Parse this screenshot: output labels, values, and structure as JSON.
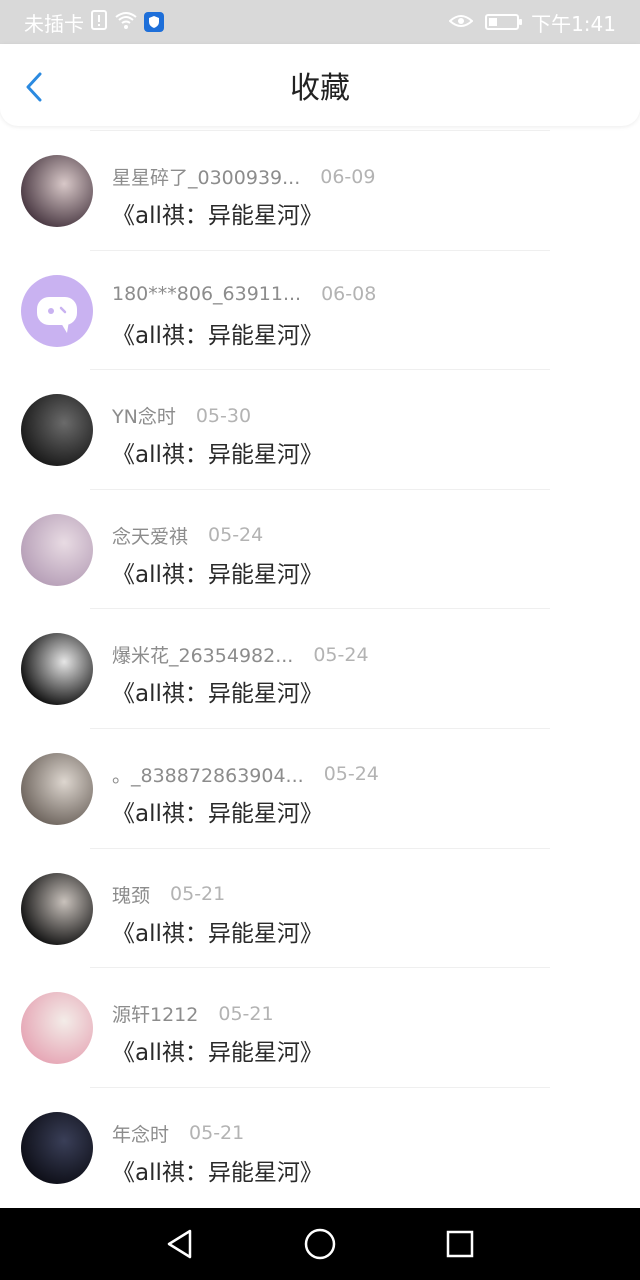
{
  "status_bar": {
    "carrier": "未插卡",
    "time": "下午1:41",
    "battery_level": 0.3
  },
  "header": {
    "title": "收藏"
  },
  "items": [
    {
      "name": "星星碎了_0300939...",
      "date": "06-09",
      "content": "《all祺：异能星河》",
      "avatar_colors": [
        "#4b3a44",
        "#d8c8c8"
      ]
    },
    {
      "name": "180***806_63911...",
      "date": "06-08",
      "content": "《all祺：异能星河》",
      "avatar_colors": [
        "#c9b2f1",
        "#ffffff"
      ]
    },
    {
      "name": "YN念时",
      "date": "05-30",
      "content": "《all祺：异能星河》",
      "avatar_colors": [
        "#1a1a1a",
        "#6b6b6b"
      ]
    },
    {
      "name": "念天爱祺",
      "date": "05-24",
      "content": "《all祺：异能星河》",
      "avatar_colors": [
        "#b7a0b8",
        "#e8dbe3"
      ]
    },
    {
      "name": "爆米花_26354982...",
      "date": "05-24",
      "content": "《all祺：异能星河》",
      "avatar_colors": [
        "#111111",
        "#e6e6e6"
      ]
    },
    {
      "name": "。_838872863904...",
      "date": "05-24",
      "content": "《all祺：异能星河》",
      "avatar_colors": [
        "#6f665f",
        "#ddd6cf"
      ]
    },
    {
      "name": "瑰颈",
      "date": "05-21",
      "content": "《all祺：异能星河》",
      "avatar_colors": [
        "#141414",
        "#c9c2bc"
      ]
    },
    {
      "name": "源轩1212",
      "date": "05-21",
      "content": "《all祺：异能星河》",
      "avatar_colors": [
        "#e6a7b6",
        "#f3ece8"
      ]
    },
    {
      "name": "年念时",
      "date": "05-21",
      "content": "《all祺：异能星河》",
      "avatar_colors": [
        "#0e0f18",
        "#3a3f58"
      ]
    }
  ],
  "colors": {
    "accent": "#2b8ae0",
    "status_bar_bg": "#d9d9d9"
  }
}
